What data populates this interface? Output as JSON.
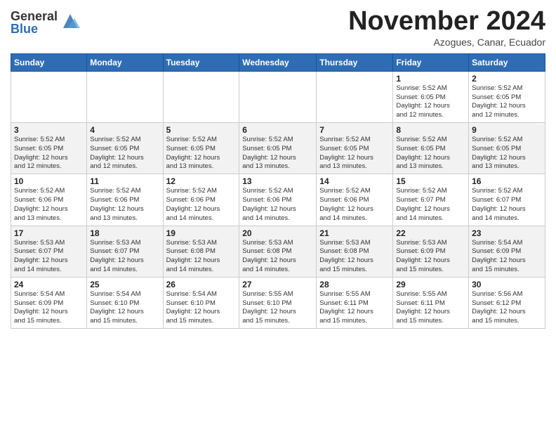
{
  "logo": {
    "general": "General",
    "blue": "Blue"
  },
  "title": "November 2024",
  "subtitle": "Azogues, Canar, Ecuador",
  "weekdays": [
    "Sunday",
    "Monday",
    "Tuesday",
    "Wednesday",
    "Thursday",
    "Friday",
    "Saturday"
  ],
  "weeks": [
    [
      {
        "day": "",
        "info": ""
      },
      {
        "day": "",
        "info": ""
      },
      {
        "day": "",
        "info": ""
      },
      {
        "day": "",
        "info": ""
      },
      {
        "day": "",
        "info": ""
      },
      {
        "day": "1",
        "info": "Sunrise: 5:52 AM\nSunset: 6:05 PM\nDaylight: 12 hours\nand 12 minutes."
      },
      {
        "day": "2",
        "info": "Sunrise: 5:52 AM\nSunset: 6:05 PM\nDaylight: 12 hours\nand 12 minutes."
      }
    ],
    [
      {
        "day": "3",
        "info": "Sunrise: 5:52 AM\nSunset: 6:05 PM\nDaylight: 12 hours\nand 12 minutes."
      },
      {
        "day": "4",
        "info": "Sunrise: 5:52 AM\nSunset: 6:05 PM\nDaylight: 12 hours\nand 12 minutes."
      },
      {
        "day": "5",
        "info": "Sunrise: 5:52 AM\nSunset: 6:05 PM\nDaylight: 12 hours\nand 13 minutes."
      },
      {
        "day": "6",
        "info": "Sunrise: 5:52 AM\nSunset: 6:05 PM\nDaylight: 12 hours\nand 13 minutes."
      },
      {
        "day": "7",
        "info": "Sunrise: 5:52 AM\nSunset: 6:05 PM\nDaylight: 12 hours\nand 13 minutes."
      },
      {
        "day": "8",
        "info": "Sunrise: 5:52 AM\nSunset: 6:05 PM\nDaylight: 12 hours\nand 13 minutes."
      },
      {
        "day": "9",
        "info": "Sunrise: 5:52 AM\nSunset: 6:05 PM\nDaylight: 12 hours\nand 13 minutes."
      }
    ],
    [
      {
        "day": "10",
        "info": "Sunrise: 5:52 AM\nSunset: 6:06 PM\nDaylight: 12 hours\nand 13 minutes."
      },
      {
        "day": "11",
        "info": "Sunrise: 5:52 AM\nSunset: 6:06 PM\nDaylight: 12 hours\nand 13 minutes."
      },
      {
        "day": "12",
        "info": "Sunrise: 5:52 AM\nSunset: 6:06 PM\nDaylight: 12 hours\nand 14 minutes."
      },
      {
        "day": "13",
        "info": "Sunrise: 5:52 AM\nSunset: 6:06 PM\nDaylight: 12 hours\nand 14 minutes."
      },
      {
        "day": "14",
        "info": "Sunrise: 5:52 AM\nSunset: 6:06 PM\nDaylight: 12 hours\nand 14 minutes."
      },
      {
        "day": "15",
        "info": "Sunrise: 5:52 AM\nSunset: 6:07 PM\nDaylight: 12 hours\nand 14 minutes."
      },
      {
        "day": "16",
        "info": "Sunrise: 5:52 AM\nSunset: 6:07 PM\nDaylight: 12 hours\nand 14 minutes."
      }
    ],
    [
      {
        "day": "17",
        "info": "Sunrise: 5:53 AM\nSunset: 6:07 PM\nDaylight: 12 hours\nand 14 minutes."
      },
      {
        "day": "18",
        "info": "Sunrise: 5:53 AM\nSunset: 6:07 PM\nDaylight: 12 hours\nand 14 minutes."
      },
      {
        "day": "19",
        "info": "Sunrise: 5:53 AM\nSunset: 6:08 PM\nDaylight: 12 hours\nand 14 minutes."
      },
      {
        "day": "20",
        "info": "Sunrise: 5:53 AM\nSunset: 6:08 PM\nDaylight: 12 hours\nand 14 minutes."
      },
      {
        "day": "21",
        "info": "Sunrise: 5:53 AM\nSunset: 6:08 PM\nDaylight: 12 hours\nand 15 minutes."
      },
      {
        "day": "22",
        "info": "Sunrise: 5:53 AM\nSunset: 6:09 PM\nDaylight: 12 hours\nand 15 minutes."
      },
      {
        "day": "23",
        "info": "Sunrise: 5:54 AM\nSunset: 6:09 PM\nDaylight: 12 hours\nand 15 minutes."
      }
    ],
    [
      {
        "day": "24",
        "info": "Sunrise: 5:54 AM\nSunset: 6:09 PM\nDaylight: 12 hours\nand 15 minutes."
      },
      {
        "day": "25",
        "info": "Sunrise: 5:54 AM\nSunset: 6:10 PM\nDaylight: 12 hours\nand 15 minutes."
      },
      {
        "day": "26",
        "info": "Sunrise: 5:54 AM\nSunset: 6:10 PM\nDaylight: 12 hours\nand 15 minutes."
      },
      {
        "day": "27",
        "info": "Sunrise: 5:55 AM\nSunset: 6:10 PM\nDaylight: 12 hours\nand 15 minutes."
      },
      {
        "day": "28",
        "info": "Sunrise: 5:55 AM\nSunset: 6:11 PM\nDaylight: 12 hours\nand 15 minutes."
      },
      {
        "day": "29",
        "info": "Sunrise: 5:55 AM\nSunset: 6:11 PM\nDaylight: 12 hours\nand 15 minutes."
      },
      {
        "day": "30",
        "info": "Sunrise: 5:56 AM\nSunset: 6:12 PM\nDaylight: 12 hours\nand 15 minutes."
      }
    ]
  ]
}
